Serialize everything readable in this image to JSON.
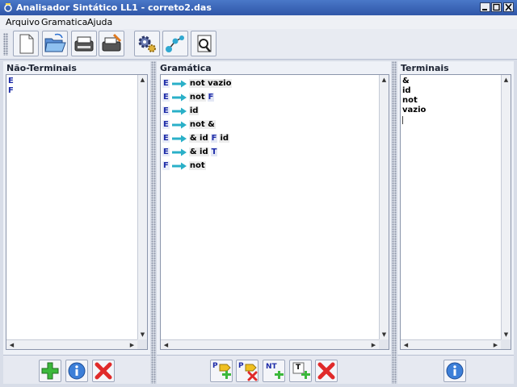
{
  "window": {
    "title": "Analisador Sintático LL1 - correto2.das"
  },
  "menu": {
    "items": [
      {
        "label": "Arquivo"
      },
      {
        "label": "Gramatica"
      },
      {
        "label": "Ajuda"
      }
    ]
  },
  "toolbar": {
    "buttons": [
      {
        "icon": "new-file-icon"
      },
      {
        "icon": "open-folder-icon"
      },
      {
        "icon": "save-icon"
      },
      {
        "icon": "save-as-icon"
      },
      {
        "icon": "settings-icon"
      },
      {
        "icon": "graph-icon"
      },
      {
        "icon": "analyze-icon"
      }
    ]
  },
  "panels": {
    "nonterminals": {
      "title": "Não-Terminais",
      "items": [
        "E",
        "F"
      ]
    },
    "grammar": {
      "title": "Gramática",
      "productions": [
        {
          "lhs": "E",
          "rhs": [
            {
              "s": "not vazio",
              "k": "t"
            }
          ]
        },
        {
          "lhs": "E",
          "rhs": [
            {
              "s": "not",
              "k": "t"
            },
            {
              "s": "F",
              "k": "nt"
            }
          ]
        },
        {
          "lhs": "E",
          "rhs": [
            {
              "s": "id",
              "k": "t"
            }
          ]
        },
        {
          "lhs": "E",
          "rhs": [
            {
              "s": "not &",
              "k": "t"
            }
          ]
        },
        {
          "lhs": "E",
          "rhs": [
            {
              "s": "& id",
              "k": "t"
            },
            {
              "s": "F",
              "k": "nt"
            },
            {
              "s": "id",
              "k": "t"
            }
          ]
        },
        {
          "lhs": "E",
          "rhs": [
            {
              "s": "& id",
              "k": "t"
            },
            {
              "s": "T",
              "k": "nt"
            }
          ]
        },
        {
          "lhs": "F",
          "rhs": [
            {
              "s": "not",
              "k": "t"
            }
          ]
        }
      ]
    },
    "terminals": {
      "title": "Terminais",
      "items": [
        "&",
        "id",
        "not",
        "vazio"
      ]
    }
  },
  "buttons": {
    "nonterminals": [
      "add-icon",
      "info-icon",
      "delete-icon"
    ],
    "grammar": [
      {
        "icon": "add-production-icon",
        "label": "P"
      },
      {
        "icon": "remove-production-icon",
        "label": "P"
      },
      {
        "icon": "add-nonterminal-icon",
        "label": "NT"
      },
      {
        "icon": "add-terminal-icon",
        "label": "T"
      },
      {
        "icon": "delete-icon",
        "label": ""
      }
    ],
    "terminals": [
      "info-icon"
    ]
  },
  "colors": {
    "titlebar": "#3a66b8",
    "nonterminal": "#1e2ca8",
    "arrow": "#2ab0c8"
  }
}
